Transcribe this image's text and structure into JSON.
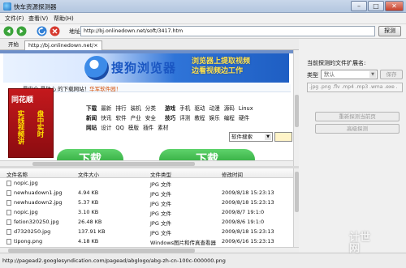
{
  "window": {
    "title": "快车资源探测器"
  },
  "menu": [
    {
      "label": "文件(F)"
    },
    {
      "label": "查看(V)"
    },
    {
      "label": "帮助(H)"
    }
  ],
  "address": {
    "label": "地址",
    "value": "http://bj.onlinedown.net/soft/3417.htm",
    "go_label": "探测"
  },
  "tabs": [
    {
      "label": "开始"
    },
    {
      "label": "http://bj.onlinedown.net/"
    }
  ],
  "web": {
    "banner_title": "搜狗浏览器",
    "promo_line1": "浏览器上提取视频",
    "promo_line2": "边看视频边工作",
    "site_line": "最安全 最放心 的下载网站！",
    "site_line_accent": "华军软件园！",
    "ad_logo": "同花顺",
    "ad_col1": "实线视频讲",
    "ad_col2": "盘中实时",
    "nav_row1": [
      "下载",
      "最新",
      "排行",
      "装机",
      "分类",
      "游戏",
      "手机",
      "驱动",
      "动漫",
      "源码",
      "Linux"
    ],
    "nav_row2": [
      "新闻",
      "快讯",
      "软件",
      "产业",
      "安全",
      "技巧",
      "评测",
      "教程",
      "娱乐",
      "编程",
      "硬件"
    ],
    "nav_row3": [
      "网站",
      "设计",
      "QQ",
      "模版",
      "插件",
      "素材"
    ],
    "search_select": "软件搜索",
    "green_btn1": "下载",
    "green_btn2": "下载"
  },
  "filelist": {
    "headers": {
      "name": "文件名称",
      "size": "文件大小",
      "type": "文件类型",
      "time": "修改时间"
    },
    "rows": [
      {
        "name": "nopic.jpg",
        "size": "",
        "type": "JPG 文件",
        "time": ""
      },
      {
        "name": "newhuadown1.jpg",
        "size": "4.94 KB",
        "type": "JPG 文件",
        "time": "2009/8/18 15:23:13"
      },
      {
        "name": "newhuadown2.jpg",
        "size": "5.37 KB",
        "type": "JPG 文件",
        "time": "2009/8/18 15:23:13"
      },
      {
        "name": "nopic.jpg",
        "size": "3.10 KB",
        "type": "JPG 文件",
        "time": "2009/8/7 19:1:0"
      },
      {
        "name": "fetion320250.jpg",
        "size": "26.48 KB",
        "type": "JPG 文件",
        "time": "2009/8/6 19:1:0"
      },
      {
        "name": "d7320250.jpg",
        "size": "137.91 KB",
        "type": "JPG 文件",
        "time": "2009/8/18 15:23:13"
      },
      {
        "name": "tipong.png",
        "size": "4.18 KB",
        "type": "Windows图片和传真查看器",
        "time": "2009/6/16 15:23:13"
      }
    ]
  },
  "rightpanel": {
    "ext_label": "当前探测的文件扩展名:",
    "type_label": "类型",
    "type_value": "默认",
    "save_label": "保存",
    "ext_value": ".jpg .png .flv .mp4 .mp3 .wma .exe .",
    "btn_reprobe": "重新探测当前页",
    "btn_advanced": "高级探测"
  },
  "status": {
    "text": "http://pagead2.googlesyndication.com/pagead/abglogo/abg-zh-cn-100c-000000.png"
  },
  "watermark": {
    "line1": "计世",
    "line2": "网"
  }
}
